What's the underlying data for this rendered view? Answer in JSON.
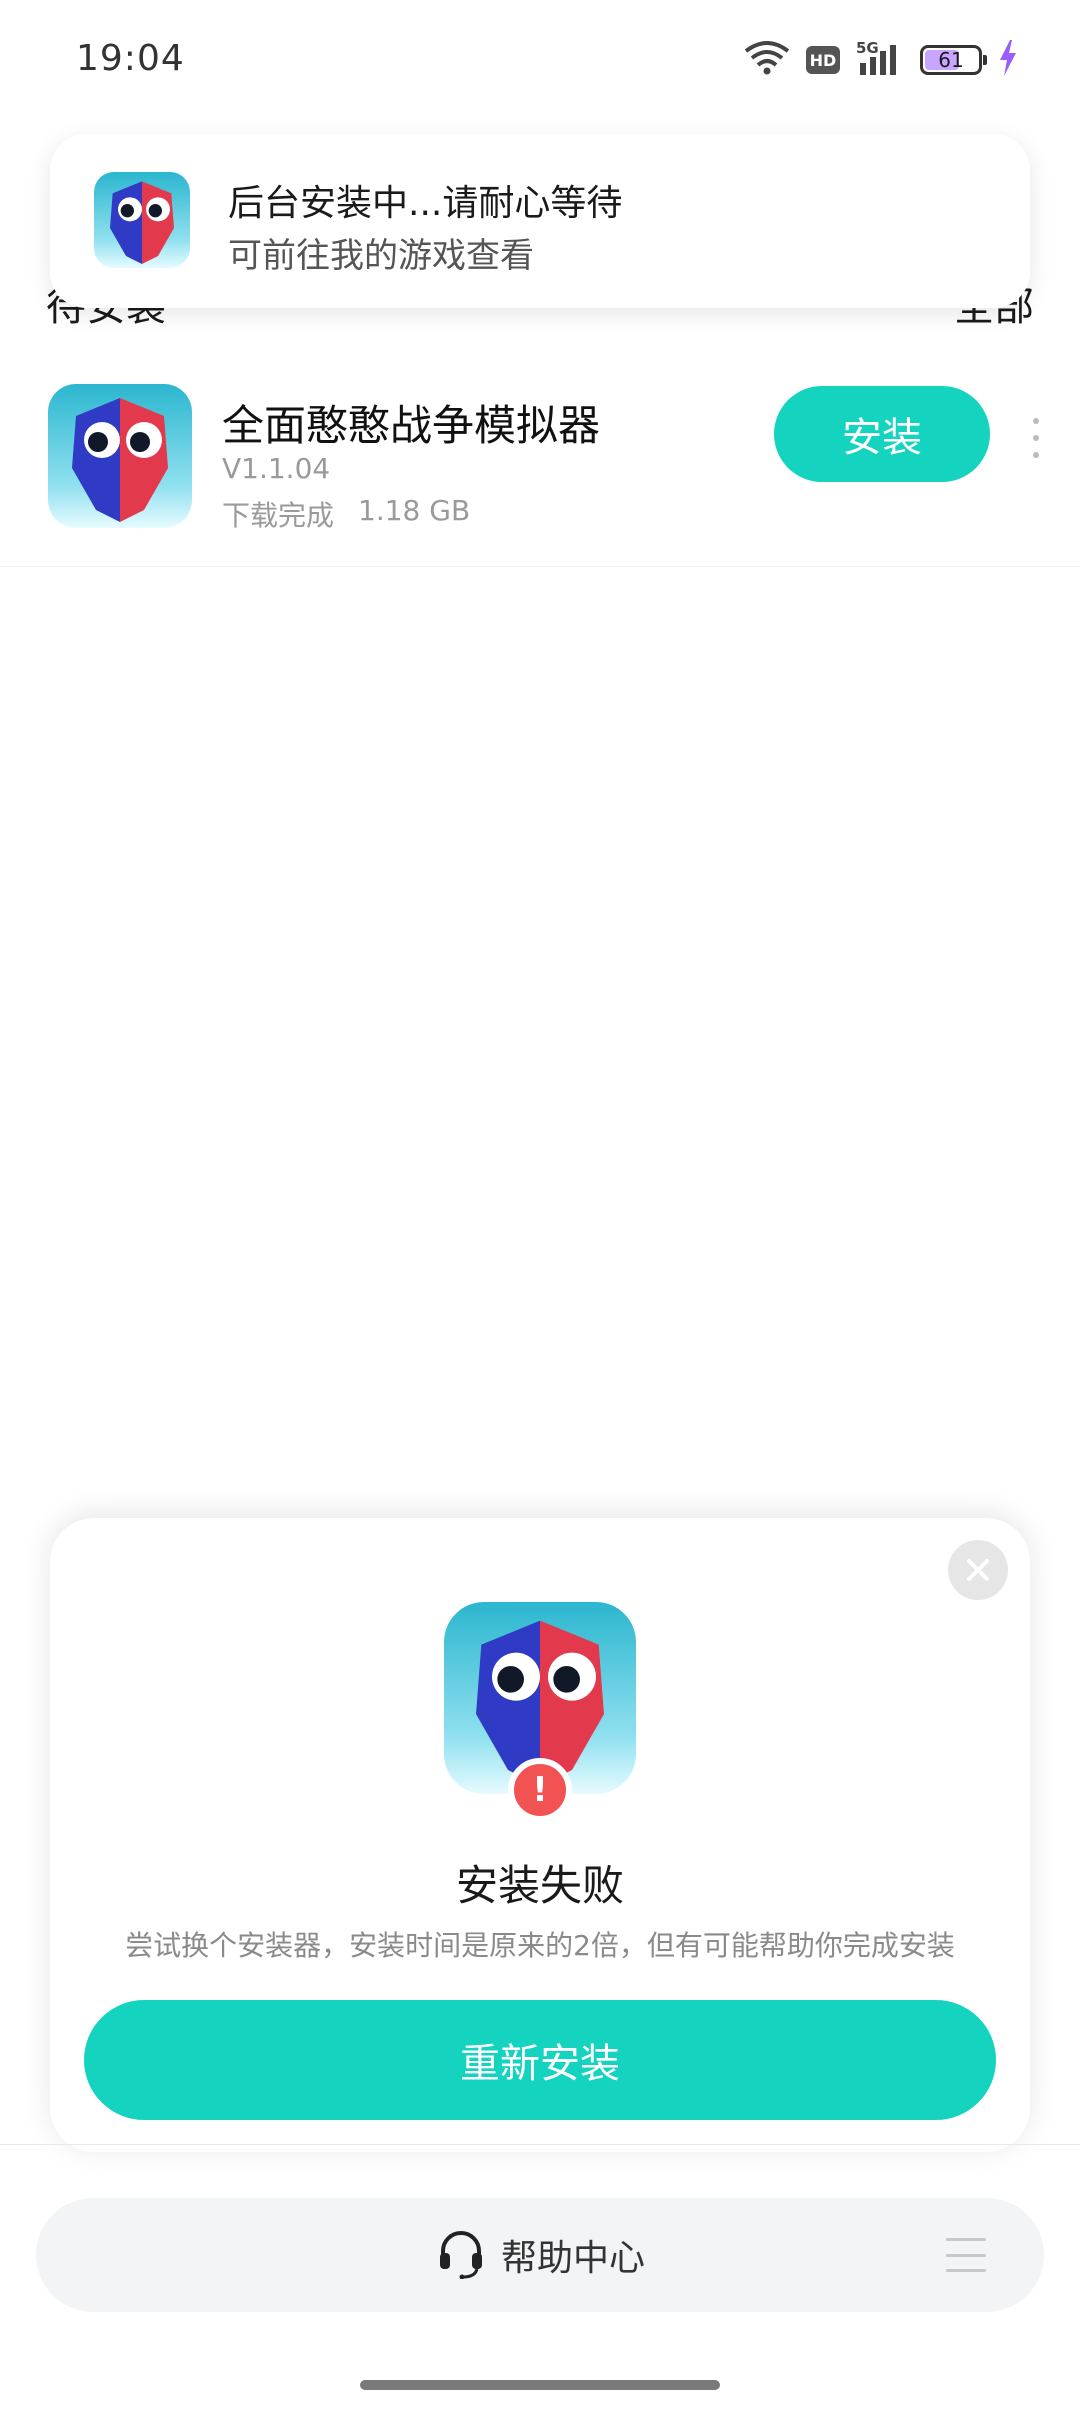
{
  "status_bar": {
    "time": "19:04",
    "hd_label": "HD",
    "network_label": "5G",
    "battery_level": "61"
  },
  "toast": {
    "title": "后台安装中...请耐心等待",
    "subtitle": "可前往我的游戏查看"
  },
  "list": {
    "partial_header_left": "待安装",
    "partial_header_right": "全部"
  },
  "app": {
    "name": "全面憨憨战争模拟器",
    "version": "V1.1.04",
    "status": "下载完成",
    "size": "1.18 GB",
    "install_label": "安装"
  },
  "dialog": {
    "title": "安装失败",
    "description": "尝试换个安装器，安装时间是原来的2倍，但有可能帮助你完成安装",
    "retry_label": "重新安装",
    "error_badge": "!"
  },
  "help_bar": {
    "label": "帮助中心"
  },
  "icons": {
    "wifi": "wifi-icon",
    "signal": "signal-icon",
    "charging": "charging-bolt-icon",
    "close": "close-icon",
    "headset": "headset-icon",
    "menu": "menu-icon",
    "more": "more-vertical-icon"
  },
  "colors": {
    "accent": "#14d4bf",
    "error": "#f25352",
    "battery_fill": "#c8a6ff",
    "charging": "#9b5cff"
  }
}
